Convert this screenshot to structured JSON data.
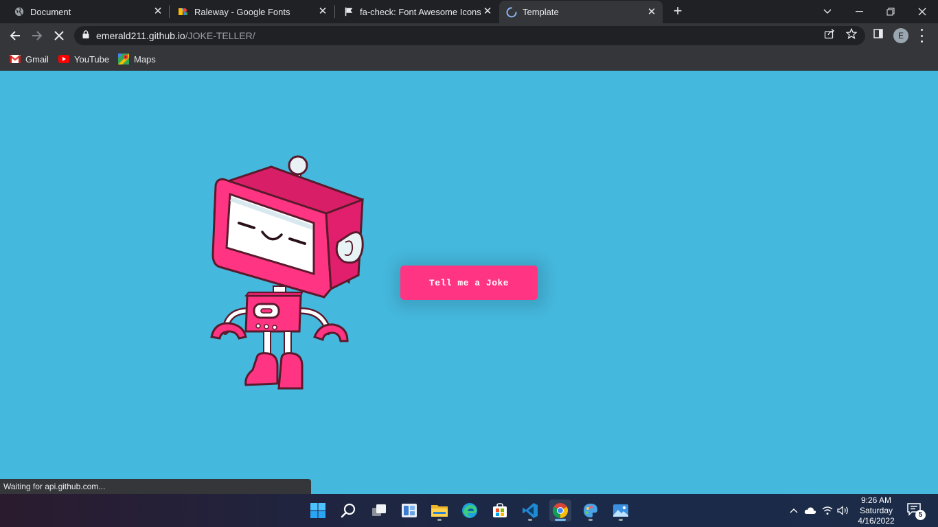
{
  "browser": {
    "tabs": [
      {
        "title": "Document",
        "icon": "globe-icon",
        "active": false
      },
      {
        "title": "Raleway - Google Fonts",
        "icon": "google-fonts-icon",
        "active": false
      },
      {
        "title": "fa-check: Font Awesome Icons",
        "icon": "flag-icon",
        "active": false
      },
      {
        "title": "Template",
        "icon": "loading-spinner-icon",
        "active": true
      }
    ],
    "new_tab_label": "+",
    "address": {
      "host": "emerald211.github.io",
      "path": "/JOKE-TELLER/"
    },
    "profile_initial": "E",
    "bookmarks": [
      {
        "label": "Gmail",
        "icon": "gmail-icon"
      },
      {
        "label": "YouTube",
        "icon": "youtube-icon"
      },
      {
        "label": "Maps",
        "icon": "maps-icon"
      }
    ],
    "status_text": "Waiting for api.github.com..."
  },
  "page": {
    "button_label": "Tell me a Joke",
    "colors": {
      "background": "#45b8dd",
      "button": "#ff3482",
      "robot": "#ff3482"
    }
  },
  "taskbar": {
    "apps": [
      "windows-start-icon",
      "search-icon",
      "task-view-icon",
      "widgets-icon",
      "file-explorer-icon",
      "edge-icon",
      "store-icon",
      "vscode-icon",
      "chrome-icon",
      "paint-icon",
      "photos-icon"
    ],
    "clock": {
      "time": "9:26 AM",
      "day": "Saturday",
      "date": "4/16/2022"
    },
    "notification_count": "5"
  }
}
